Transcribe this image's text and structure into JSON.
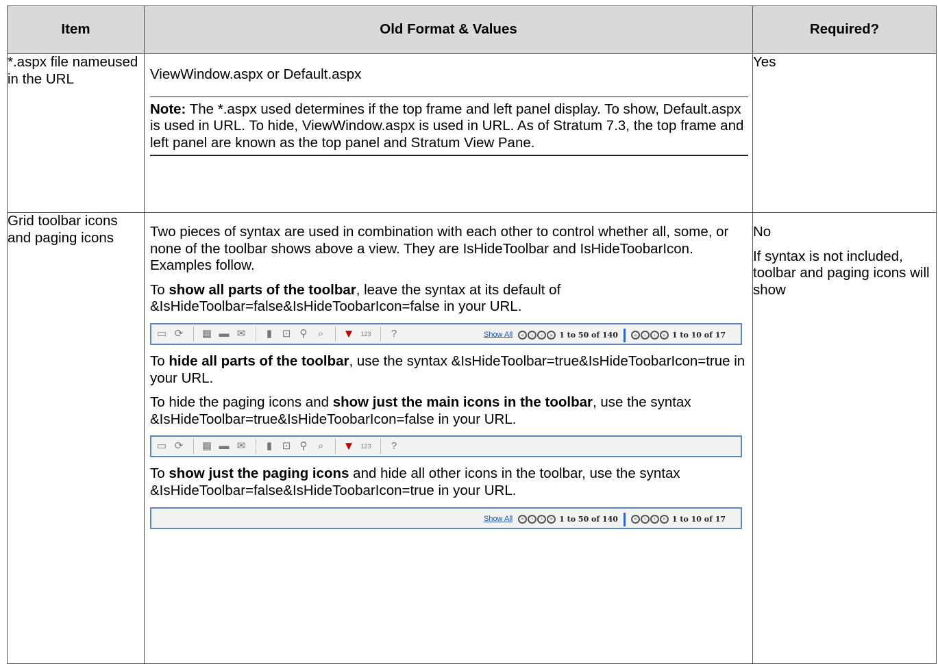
{
  "headers": {
    "item": "Item",
    "old": "Old Format & Values",
    "required": "Required?"
  },
  "row1": {
    "item": "*.aspx file nameused in the URL",
    "value": "ViewWindow.aspx or Default.aspx",
    "note_label": "Note:",
    "note_text": " The *.aspx used determines if the top frame and left panel display. To show, Default.aspx is used in URL. To hide, ViewWindow.aspx is used in URL. As of Stratum 7.3, the top frame and left panel are known as the top panel and Stratum View Pane.",
    "required": "Yes"
  },
  "row2": {
    "item": "Grid toolbar icons and paging icons",
    "intro": "Two pieces of syntax are used in combination with each other to control whether all, some, or none of the toolbar shows above a view. They are IsHideToolbar and IsHideToobarIcon. Examples follow.",
    "show_all_pre": "To ",
    "show_all_bold": "show all parts of the toolbar",
    "show_all_post": ", leave the syntax at its default of &IsHideToolbar=false&IsHideToobarIcon=false in your URL.",
    "hide_all_pre": "To ",
    "hide_all_bold": "hide all parts of the toolbar",
    "hide_all_post": ", use the syntax &IsHideToolbar=true&IsHideToobarIcon=true in your URL.",
    "main_pre": "To hide the paging icons and ",
    "main_bold": "show just the main icons in the toolbar",
    "main_post": ", use the syntax &IsHideToolbar=true&IsHideToobarIcon=false in your URL.",
    "paging_pre": "To ",
    "paging_bold": "show just the paging icons",
    "paging_post": " and hide all other icons in the toolbar, use the syntax &IsHideToolbar=false&IsHideToobarIcon=true in your URL.",
    "required_1": "No",
    "required_2": "If syntax is not included, toolbar and paging icons will show"
  },
  "toolbar": {
    "show_all": "Show All",
    "range_1": "1 to 50 of 140",
    "range_2": "1 to 10 of 17",
    "calc_label": "123",
    "icons": [
      "save-icon",
      "refresh-icon",
      "excel-icon",
      "print-icon",
      "email-icon",
      "chart-icon",
      "zoom-icon",
      "map-pin-icon",
      "search-icon",
      "filter-icon",
      "calculator-icon",
      "help-icon"
    ]
  }
}
